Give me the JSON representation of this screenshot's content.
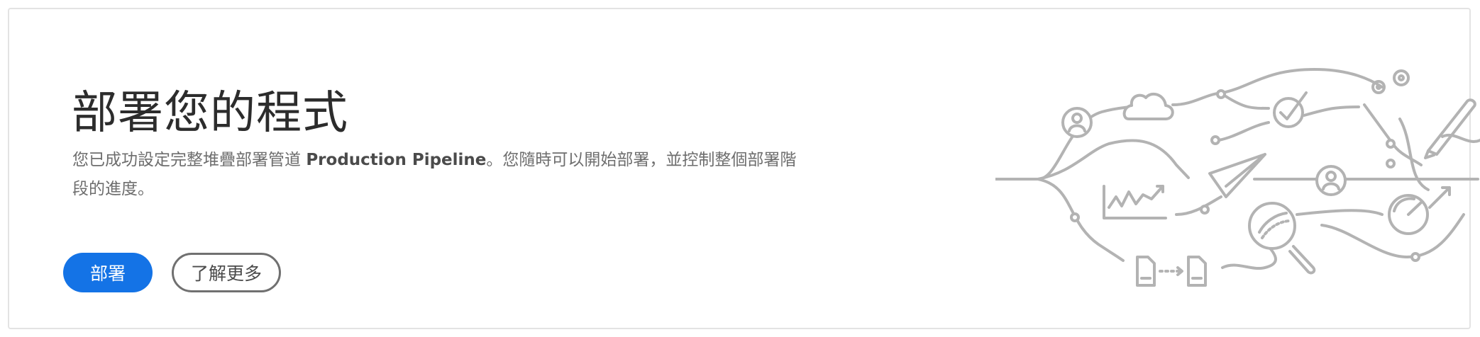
{
  "card": {
    "title": "部署您的程式",
    "description": {
      "before": "您已成功設定完整堆疊部署管道 ",
      "pipeline_name": "Production Pipeline",
      "after": "。您隨時可以開始部署，並控制整個部署階段的進度。"
    },
    "buttons": {
      "deploy_label": "部署",
      "learn_more_label": "了解更多"
    }
  },
  "colors": {
    "primary": "#1473e6",
    "illustration": "#b3b3b3",
    "title": "#2c2c2c",
    "text": "#6e6e6e"
  },
  "illustration": {
    "icons": [
      "user-icon",
      "cloud-icon",
      "checkmark-icon",
      "gears-icon",
      "pen-icon",
      "chart-icon",
      "paper-plane-icon",
      "user-icon",
      "gauge-icon",
      "arrow-icon",
      "document-icon",
      "search-icon"
    ]
  }
}
